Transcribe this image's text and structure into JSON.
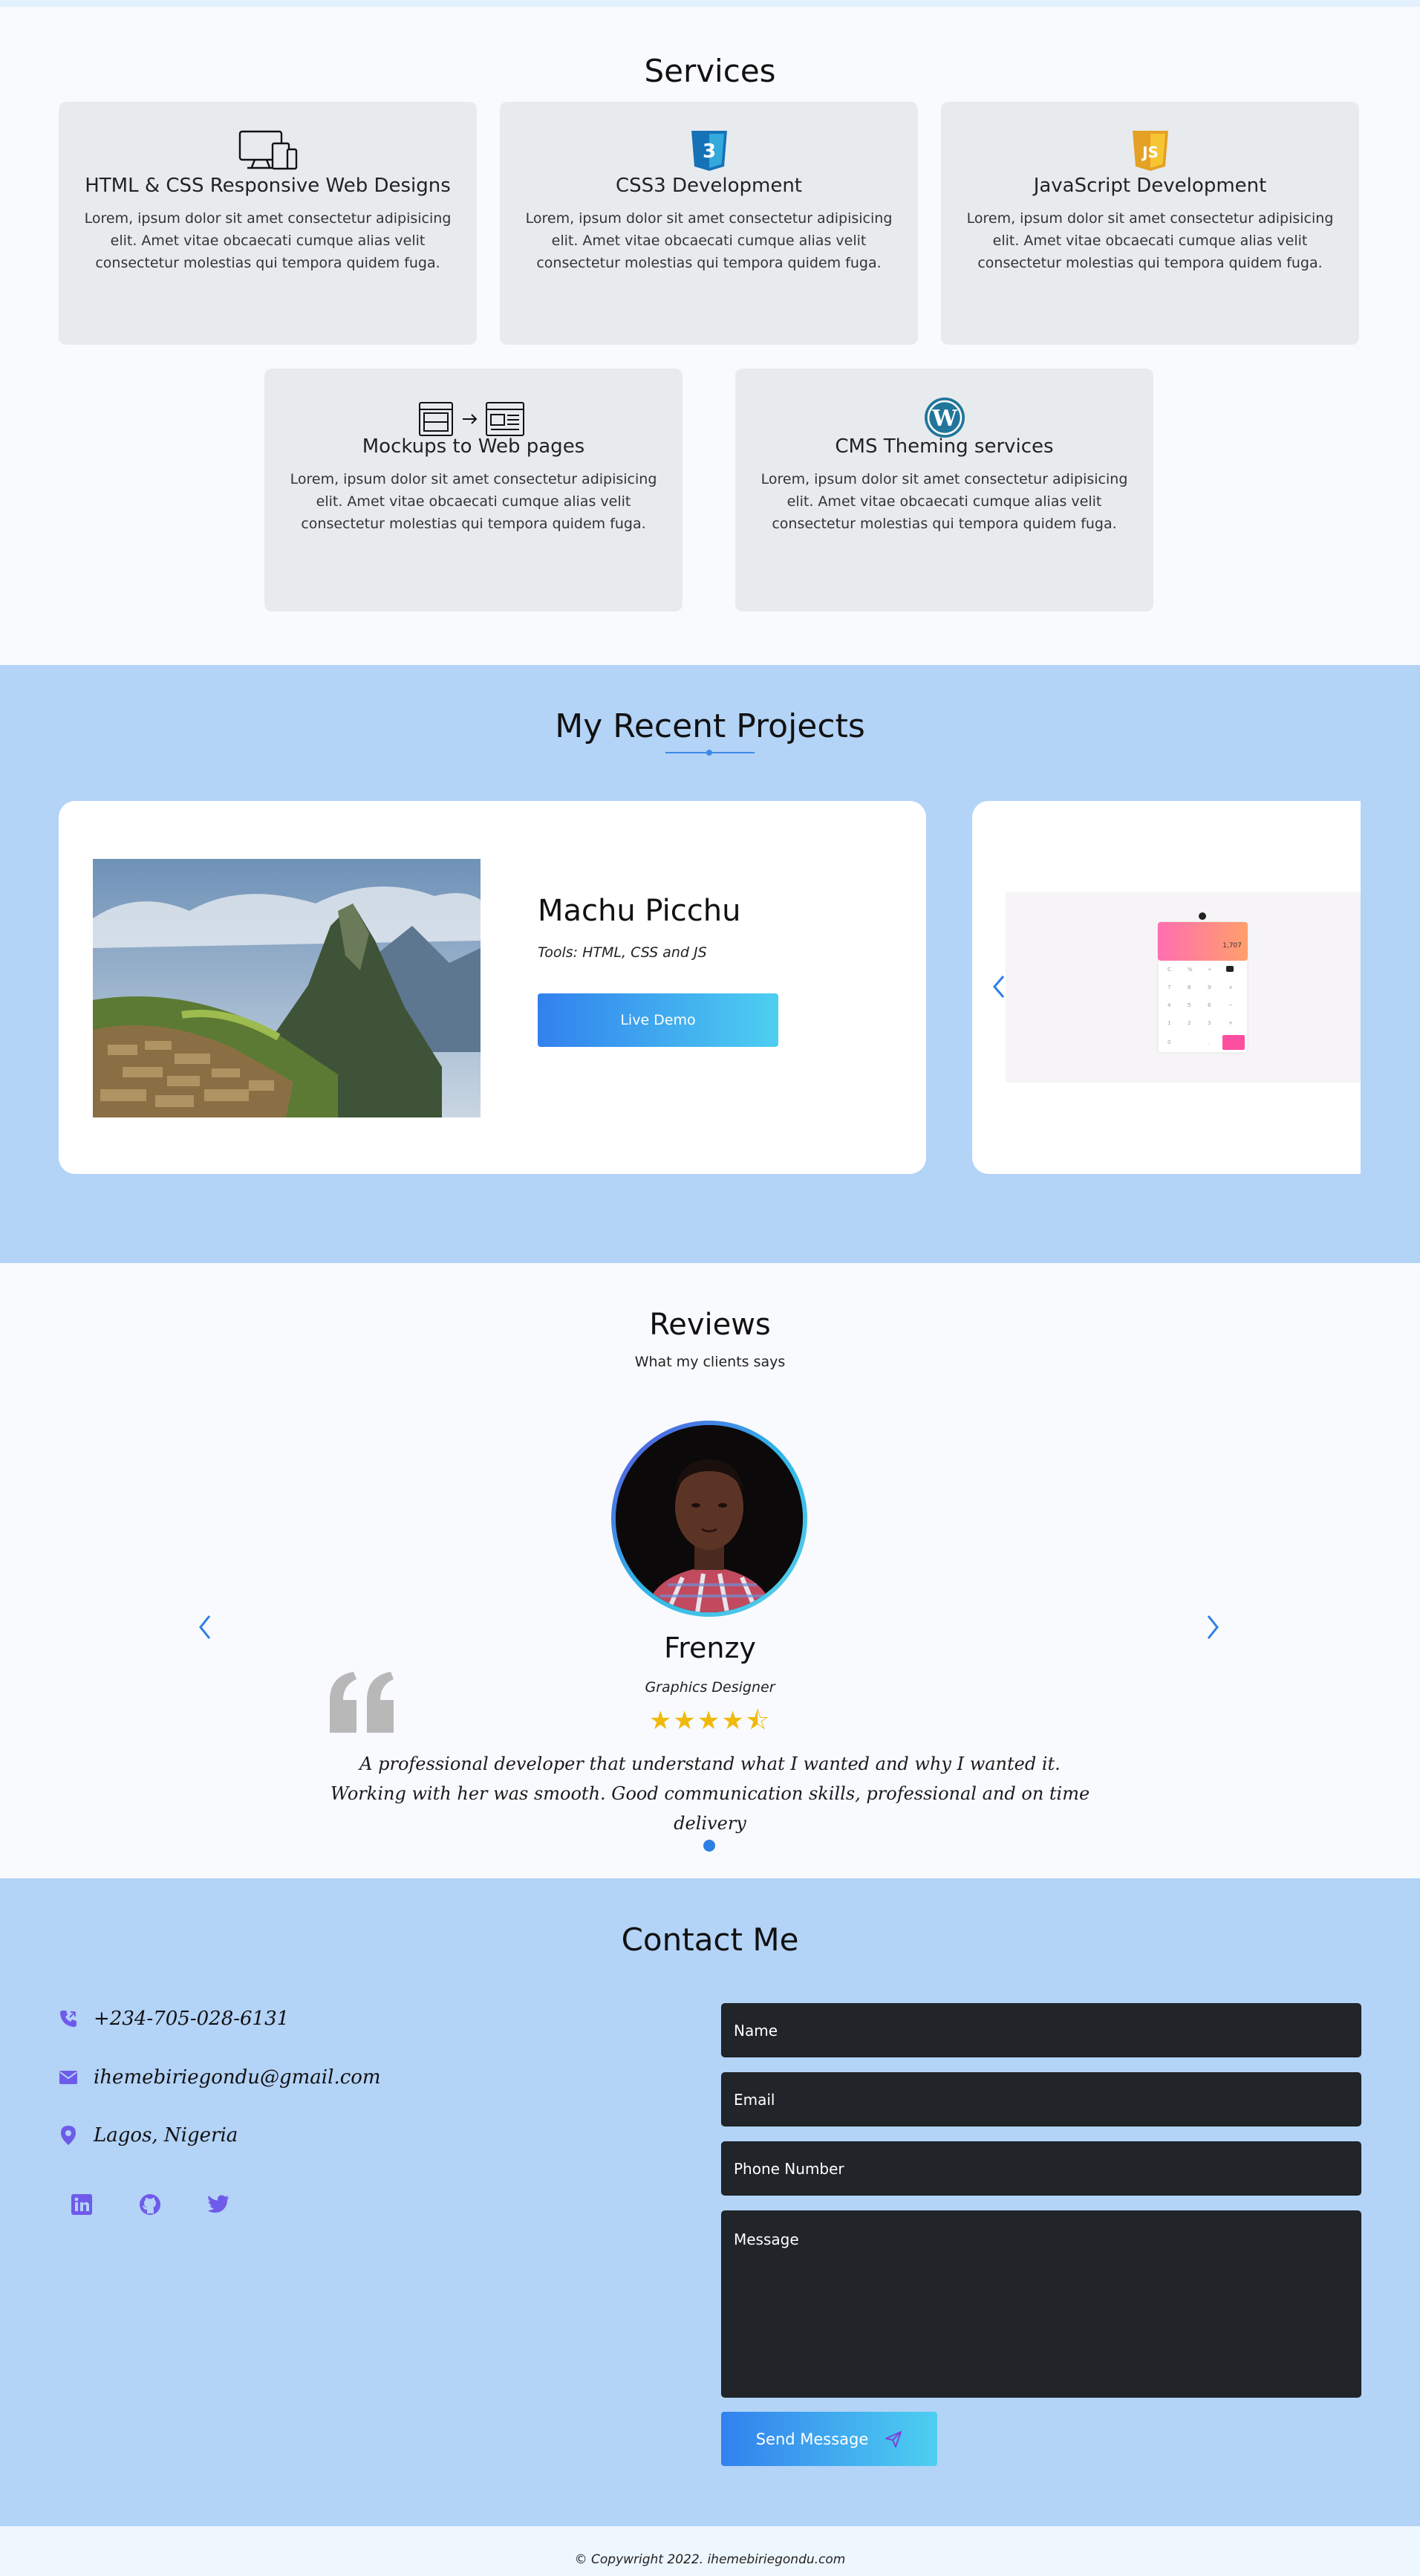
{
  "services": {
    "title": "Services",
    "cards": [
      {
        "icon": "devices-icon",
        "title": "HTML & CSS Responsive Web Designs",
        "desc": "Lorem, ipsum dolor sit amet consectetur adipisicing elit. Amet vitae obcaecati cumque alias velit consectetur molestias qui tempora quidem fuga."
      },
      {
        "icon": "css3-icon",
        "title": "CSS3 Development",
        "desc": "Lorem, ipsum dolor sit amet consectetur adipisicing elit. Amet vitae obcaecati cumque alias velit consectetur molestias qui tempora quidem fuga."
      },
      {
        "icon": "javascript-icon",
        "title": "JavaScript Development",
        "desc": "Lorem, ipsum dolor sit amet consectetur adipisicing elit. Amet vitae obcaecati cumque alias velit consectetur molestias qui tempora quidem fuga."
      },
      {
        "icon": "mockup-to-web-icon",
        "title": "Mockups to Web pages",
        "desc": "Lorem, ipsum dolor sit amet consectetur adipisicing elit. Amet vitae obcaecati cumque alias velit consectetur molestias qui tempora quidem fuga."
      },
      {
        "icon": "wordpress-icon",
        "title": "CMS Theming services",
        "desc": "Lorem, ipsum dolor sit amet consectetur adipisicing elit. Amet vitae obcaecati cumque alias velit consectetur molestias qui tempora quidem fuga."
      }
    ]
  },
  "projects": {
    "title": "My Recent Projects",
    "items": [
      {
        "name": "Machu Picchu",
        "tools": "Tools: HTML, CSS and JS",
        "button": "Live Demo"
      }
    ],
    "calculator_display": "1,707"
  },
  "reviews": {
    "title": "Reviews",
    "subtitle": "What my clients says",
    "name": "Frenzy",
    "role": "Graphics Designer",
    "rating": 4.5,
    "stars": "★★★★⯪",
    "text": "A professional developer that understand what I wanted and why I wanted it. Working with her was smooth. Good communication skills, professional and on time delivery"
  },
  "contact": {
    "title": "Contact Me",
    "phone": "+234-705-028-6131",
    "email": "ihemebiriegondu@gmail.com",
    "location": "Lagos, Nigeria",
    "form": {
      "name_placeholder": "Name",
      "email_placeholder": "Email",
      "phone_placeholder": "Phone Number",
      "message_placeholder": "Message",
      "submit": "Send Message"
    },
    "accent": "#6f5bea"
  },
  "footer": {
    "copyright": "© Copywright 2022. ihemebiriegondu.com"
  }
}
